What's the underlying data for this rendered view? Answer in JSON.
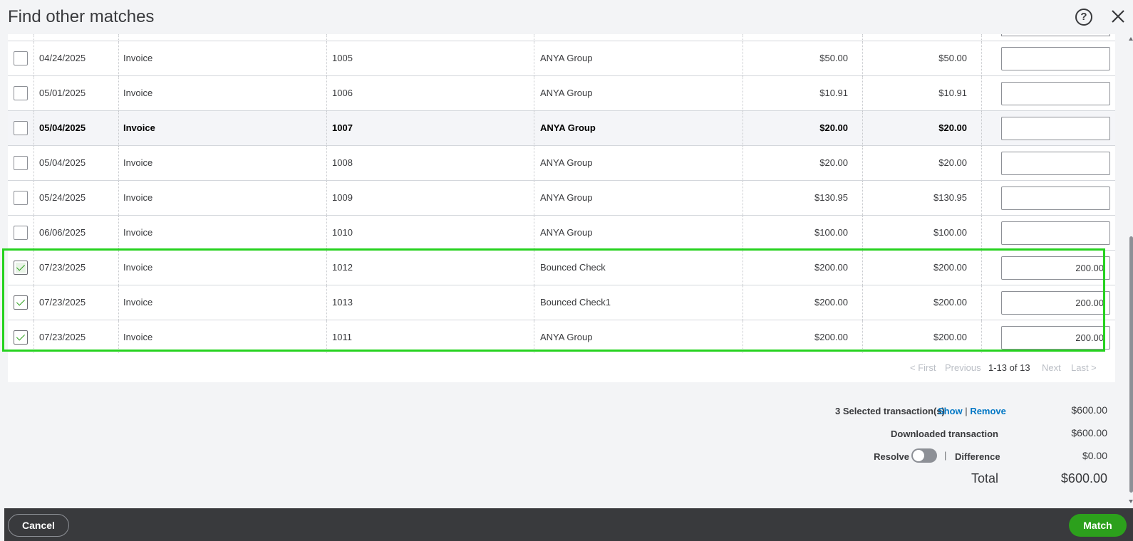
{
  "title": "Find other matches",
  "rows": [
    {
      "checked": false,
      "date": "04/24/2025",
      "type": "Invoice",
      "ref": "1005",
      "payee": "ANYA Group",
      "original": "$50.00",
      "open": "$50.00",
      "payment": ""
    },
    {
      "checked": false,
      "date": "05/01/2025",
      "type": "Invoice",
      "ref": "1006",
      "payee": "ANYA Group",
      "original": "$10.91",
      "open": "$10.91",
      "payment": ""
    },
    {
      "checked": false,
      "date": "05/04/2025",
      "type": "Invoice",
      "ref": "1007",
      "payee": "ANYA Group",
      "original": "$20.00",
      "open": "$20.00",
      "payment": ""
    },
    {
      "checked": false,
      "date": "05/04/2025",
      "type": "Invoice",
      "ref": "1008",
      "payee": "ANYA Group",
      "original": "$20.00",
      "open": "$20.00",
      "payment": ""
    },
    {
      "checked": false,
      "date": "05/24/2025",
      "type": "Invoice",
      "ref": "1009",
      "payee": "ANYA Group",
      "original": "$130.95",
      "open": "$130.95",
      "payment": ""
    },
    {
      "checked": false,
      "date": "06/06/2025",
      "type": "Invoice",
      "ref": "1010",
      "payee": "ANYA Group",
      "original": "$100.00",
      "open": "$100.00",
      "payment": ""
    },
    {
      "checked": true,
      "date": "07/23/2025",
      "type": "Invoice",
      "ref": "1012",
      "payee": "Bounced Check",
      "original": "$200.00",
      "open": "$200.00",
      "payment": "200.00"
    },
    {
      "checked": true,
      "date": "07/23/2025",
      "type": "Invoice",
      "ref": "1013",
      "payee": "Bounced Check1",
      "original": "$200.00",
      "open": "$200.00",
      "payment": "200.00"
    },
    {
      "checked": true,
      "date": "07/23/2025",
      "type": "Invoice",
      "ref": "1011",
      "payee": "ANYA Group",
      "original": "$200.00",
      "open": "$200.00",
      "payment": "200.00"
    }
  ],
  "pager": {
    "first": "< First",
    "previous": "Previous",
    "range": "1-13 of 13",
    "next": "Next",
    "last": "Last >"
  },
  "summary": {
    "selected_label": "3 Selected transaction(s)",
    "show_link": "Show",
    "divider": "|",
    "remove_link": "Remove",
    "selected_amount": "$600.00",
    "downloaded_label": "Downloaded transaction",
    "downloaded_amount": "$600.00",
    "resolve_label": "Resolve",
    "resolve_on": false,
    "difference_label": "Difference",
    "difference_amount": "$0.00",
    "total_label": "Total",
    "total_amount": "$600.00"
  },
  "footer": {
    "cancel_label": "Cancel",
    "match_label": "Match"
  },
  "colors": {
    "accent_green": "#2ca01c",
    "highlight": "#26d21f",
    "link_blue": "#0077c5",
    "footer_bg": "#393a3d"
  },
  "icons": {
    "help": "help-icon",
    "close": "close-icon"
  }
}
